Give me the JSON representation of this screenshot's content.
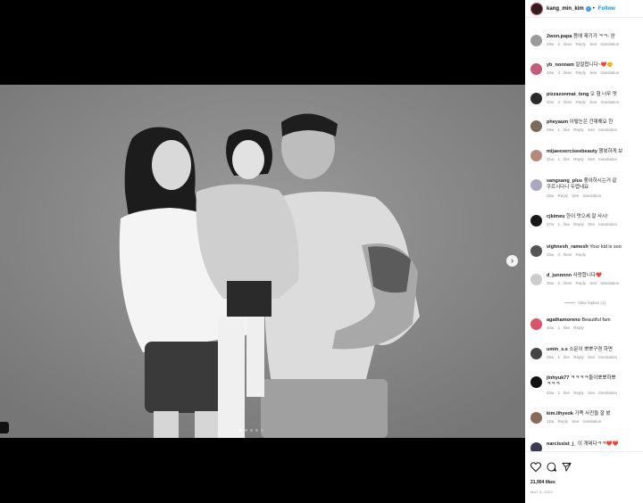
{
  "post": {
    "author": "kang_min_kim",
    "follow_label": "Follow",
    "likes": "21,904 likes",
    "date": "MAY 8, 2022"
  },
  "media": {
    "photo_description": "",
    "dot_count": 5
  },
  "comments": [
    {
      "user": "2won.papa",
      "text": "몸에 제기가 ㅋㅋ- 완",
      "meta": "29w 2 likes Reply See translation",
      "color": "#9a9a9a"
    },
    {
      "user": "yb_nonnam",
      "text": "잘말합니다~❤️😊",
      "meta": "40w 3 likes Reply See translation",
      "color": "#c25d7a"
    },
    {
      "user": "pizzazonmat_teng",
      "text": "오 형 너무 멋",
      "meta": "40w 3 likes Reply See translation",
      "color": "#2a2a2a"
    },
    {
      "user": "pheyaum",
      "text": "이렇눈은 건재해요 한",
      "meta": "29w 1 like Reply See translation",
      "color": "#7c6a5a"
    },
    {
      "user": "mijaeexerciseebeauty",
      "text": "행복하게 보",
      "meta": "31w 1 like Reply See translation",
      "color": "#b58a7a"
    },
    {
      "user": "sangsang_plus",
      "text": "좋아하시는거 같",
      "text2": "쿠르시다니 두렵네요",
      "meta": "45w Reply See translation",
      "color": "#a8a8c0"
    },
    {
      "user": "cjkimeu",
      "text": "한이 멋으세 잘 사시!",
      "meta": "27w 1 like Reply See translation",
      "color": "#1a1a1a"
    },
    {
      "user": "vighnesh_ramesh",
      "text": "Your kid is soo",
      "meta": "45w 3 likes Reply",
      "color": "#555555"
    },
    {
      "user": "d_junnnnn",
      "text": "사랑합니다❤️",
      "meta": "40w 2 likes Reply See translation",
      "color": "#cccccc"
    },
    {
      "user": "agathamoreno",
      "text": "Beautiful fam",
      "meta": "40w 1 like Reply",
      "color": "#d9546a"
    },
    {
      "user": "umin_s.s",
      "text": "소문이 뽀뽀구경 하면",
      "meta": "29w 1 like Reply See translation",
      "color": "#444444"
    },
    {
      "user": "jinhyuk77",
      "text": "ㅋㅋㅋㅋ둘이뽀뽀하뽀",
      "text2": "ㅋㅋㅋ",
      "meta": "40w 1 like Reply See translation",
      "color": "#111111"
    },
    {
      "user": "kim.lihyeok",
      "text": "가족 사진들 잘 봤",
      "meta": "12w Reply See translation",
      "color": "#8a6a5a"
    },
    {
      "user": "narcissist_j_",
      "text": "이 개쩌다ㅋㅋ❤️❤️",
      "meta": "",
      "color": "#3a3a55"
    }
  ],
  "view_replies": "View replies (1)",
  "colors": {
    "accent": "#0095f6",
    "verified": "#3897f0"
  },
  "icons": [
    "heart-icon",
    "comment-icon",
    "share-icon"
  ]
}
